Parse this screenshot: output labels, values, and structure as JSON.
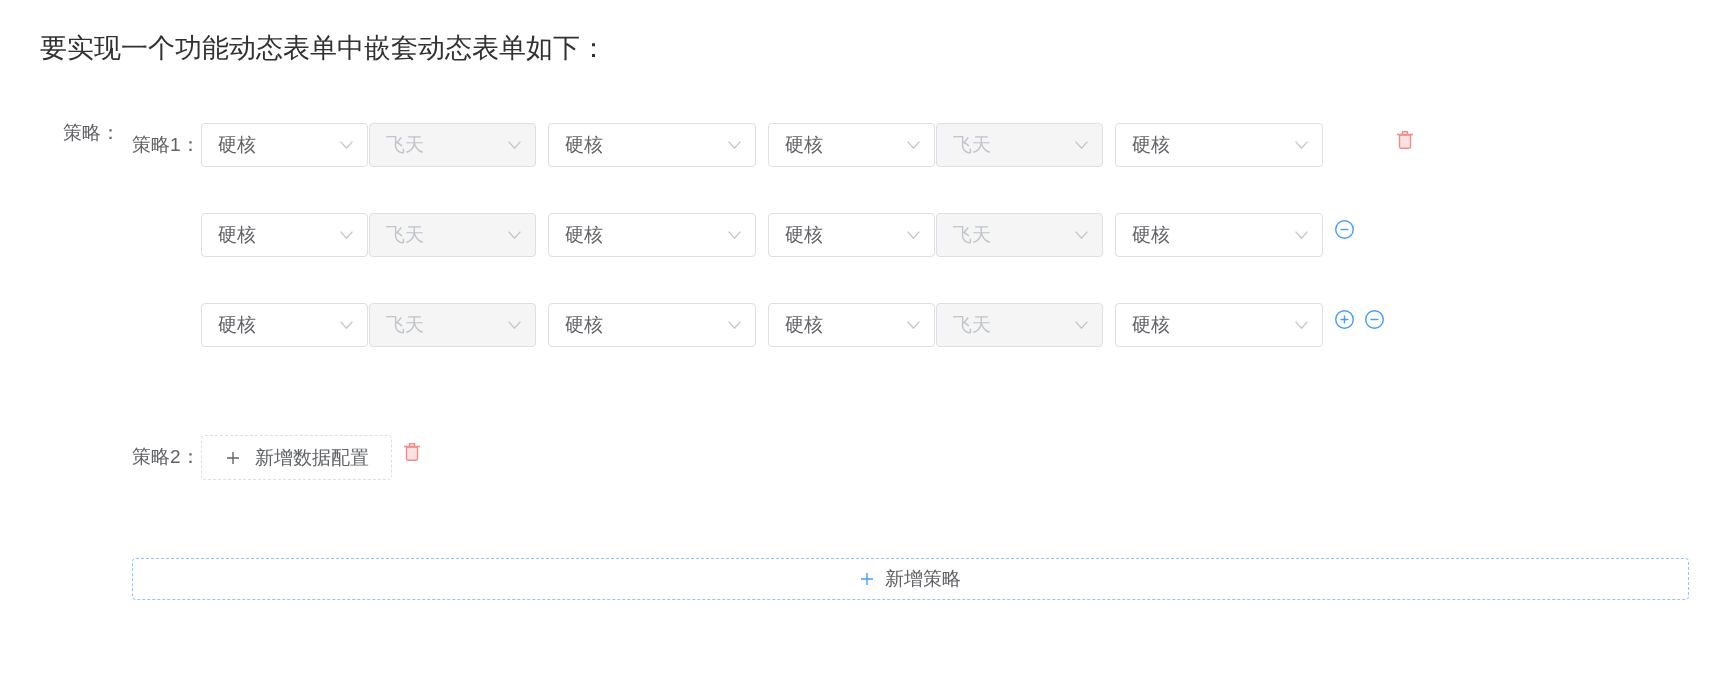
{
  "title": "要实现一个功能动态表单中嵌套动态表单如下：",
  "form": {
    "label": "策略：",
    "strategies": [
      {
        "label": "策略1：",
        "rows": [
          {
            "groups": [
              [
                {
                  "value": "硬核",
                  "disabled": false
                },
                {
                  "value": "飞天",
                  "disabled": true
                }
              ],
              [
                {
                  "value": "硬核",
                  "disabled": false
                }
              ],
              [
                {
                  "value": "硬核",
                  "disabled": false
                },
                {
                  "value": "飞天",
                  "disabled": true
                }
              ],
              [
                {
                  "value": "硬核",
                  "disabled": false
                }
              ]
            ]
          },
          {
            "groups": [
              [
                {
                  "value": "硬核",
                  "disabled": false
                },
                {
                  "value": "飞天",
                  "disabled": true
                }
              ],
              [
                {
                  "value": "硬核",
                  "disabled": false
                }
              ],
              [
                {
                  "value": "硬核",
                  "disabled": false
                },
                {
                  "value": "飞天",
                  "disabled": true
                }
              ],
              [
                {
                  "value": "硬核",
                  "disabled": false
                }
              ]
            ],
            "actions": [
              {
                "kind": "remove"
              }
            ]
          },
          {
            "groups": [
              [
                {
                  "value": "硬核",
                  "disabled": false
                },
                {
                  "value": "飞天",
                  "disabled": true
                }
              ],
              [
                {
                  "value": "硬核",
                  "disabled": false
                }
              ],
              [
                {
                  "value": "硬核",
                  "disabled": false
                },
                {
                  "value": "飞天",
                  "disabled": true
                }
              ],
              [
                {
                  "value": "硬核",
                  "disabled": false
                }
              ]
            ],
            "actions": [
              {
                "kind": "add"
              },
              {
                "kind": "remove"
              }
            ]
          }
        ]
      },
      {
        "label": "策略2：",
        "add_button": "新增数据配置"
      }
    ],
    "add_button": "新增策略"
  }
}
